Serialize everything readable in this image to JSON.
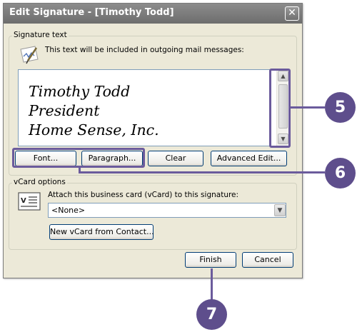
{
  "window": {
    "title": "Edit Signature - [Timothy Todd]",
    "close_glyph": "✕"
  },
  "signature_text": {
    "group_label": "Signature text",
    "description": "This text will be included in outgoing mail messages:",
    "lines": [
      "Timothy Todd",
      "President",
      "Home Sense, Inc."
    ],
    "buttons": {
      "font": "Font...",
      "paragraph": "Paragraph...",
      "clear": "Clear",
      "advanced_edit": "Advanced Edit..."
    }
  },
  "vcard": {
    "group_label": "vCard options",
    "attach_label": "Attach this business card (vCard) to this signature:",
    "selected": "<None>",
    "new_from_contact": "New vCard from Contact..."
  },
  "footer": {
    "finish": "Finish",
    "cancel": "Cancel"
  },
  "callouts": {
    "c5": "5",
    "c6": "6",
    "c7": "7"
  },
  "colors": {
    "callout": "#5e4e8c",
    "callout_line": "#6b5b9c",
    "title_bar": "#7d7d7d",
    "dialog_bg": "#ece9d8",
    "button_border": "#003c74"
  }
}
